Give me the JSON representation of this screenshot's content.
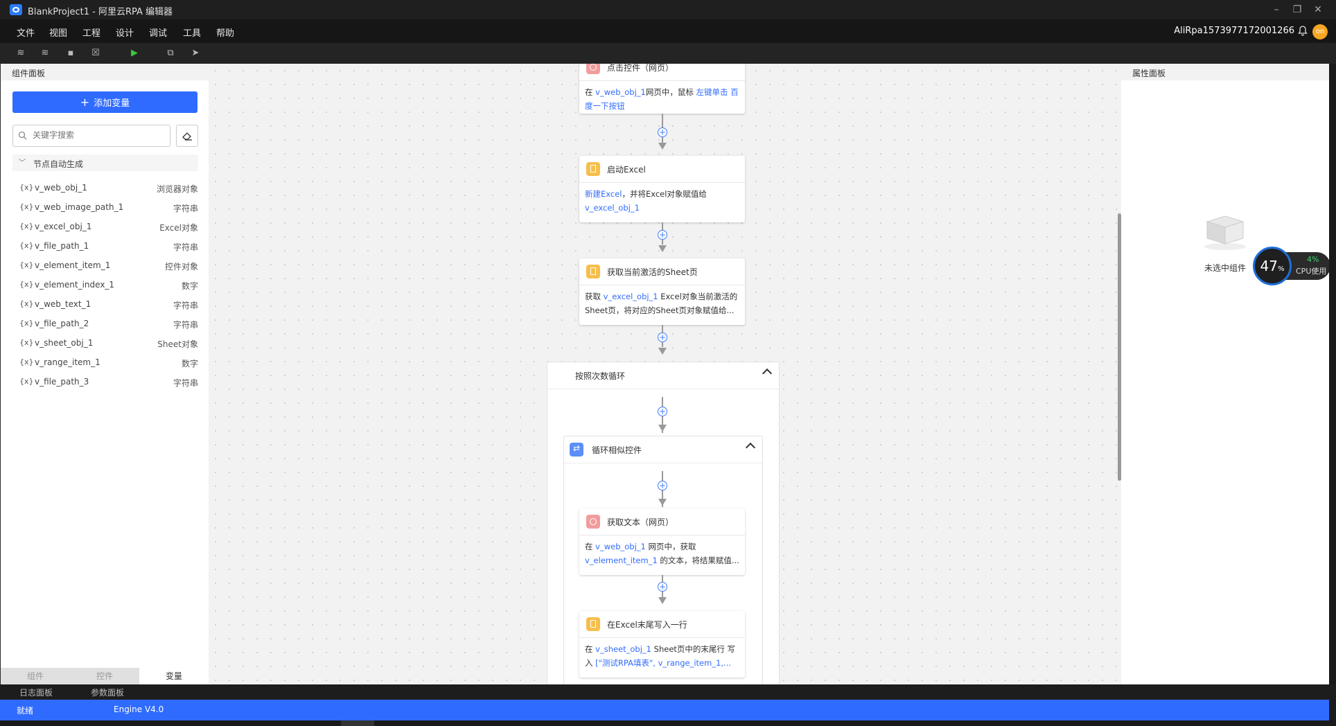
{
  "window": {
    "title": "BlankProject1 - 阿里云RPA 编辑器"
  },
  "menu": [
    "文件",
    "视图",
    "工程",
    "设计",
    "调试",
    "工具",
    "帮助"
  ],
  "user": {
    "name": "AliRpa1573977172001266",
    "notification_count": "1",
    "avatar_text": "on"
  },
  "left_panel": {
    "title": "组件面板",
    "add_button": "添加变量",
    "search_placeholder": "关键字搜索",
    "group_label": "节点自动生成",
    "variables": [
      {
        "name": "v_web_obj_1",
        "type": "浏览器对象"
      },
      {
        "name": "v_web_image_path_1",
        "type": "字符串"
      },
      {
        "name": "v_excel_obj_1",
        "type": "Excel对象"
      },
      {
        "name": "v_file_path_1",
        "type": "字符串"
      },
      {
        "name": "v_element_item_1",
        "type": "控件对象"
      },
      {
        "name": "v_element_index_1",
        "type": "数字"
      },
      {
        "name": "v_web_text_1",
        "type": "字符串"
      },
      {
        "name": "v_file_path_2",
        "type": "字符串"
      },
      {
        "name": "v_sheet_obj_1",
        "type": "Sheet对象"
      },
      {
        "name": "v_range_item_1",
        "type": "数字"
      },
      {
        "name": "v_file_path_3",
        "type": "字符串"
      }
    ],
    "tabs": [
      "组件",
      "控件",
      "变量"
    ],
    "active_tab": "变量"
  },
  "flow": {
    "node1": {
      "title": "点击控件（网页）",
      "desc_pre": "在 ",
      "desc_var": "v_web_obj_1",
      "desc_mid": "网页中，鼠标 ",
      "desc_action": "左键单击 百度一下按钮"
    },
    "node2": {
      "title": "启动Excel",
      "desc_link": "新建Excel",
      "desc_mid": "，并将Excel对象赋值给 ",
      "desc_var": "v_excel_obj_1"
    },
    "node3": {
      "title": "获取当前激活的Sheet页",
      "desc_pre": "获取 ",
      "desc_var": "v_excel_obj_1",
      "desc_rest": " Excel对象当前激活的Sheet页，将对应的Sheet页对象赋值给..."
    },
    "loop1": {
      "title": "按照次数循环"
    },
    "loop2": {
      "title": "循环相似控件"
    },
    "node4": {
      "title": "获取文本（网页）",
      "desc_pre": "在 ",
      "desc_var": "v_web_obj_1",
      "desc_mid": " 网页中，获取 ",
      "desc_var2": "v_element_item_1",
      "desc_rest": " 的文本，将结果赋值..."
    },
    "node5": {
      "title": "在Excel末尾写入一行",
      "desc_pre": "在 ",
      "desc_var": "v_sheet_obj_1",
      "desc_mid": " Sheet页中的末尾行 写入 ",
      "desc_val": "[\"测试RPA填表\", v_range_item_1,..."
    }
  },
  "right_panel": {
    "title": "属性面板",
    "empty_text": "未选中组件"
  },
  "cpu": {
    "percent": "47",
    "unit": "%",
    "usage": "4%",
    "label": "CPU使用"
  },
  "bottom_tabs": [
    "日志面板",
    "参数面板"
  ],
  "status": {
    "state": "就绪",
    "engine": "Engine V4.0"
  },
  "colors": {
    "accent": "#2f6bff",
    "status_bar": "#2f6bff",
    "web_icon": "#f19c9c",
    "excel_icon": "#f6bf4b",
    "loop_icon": "#5b8ef7"
  }
}
